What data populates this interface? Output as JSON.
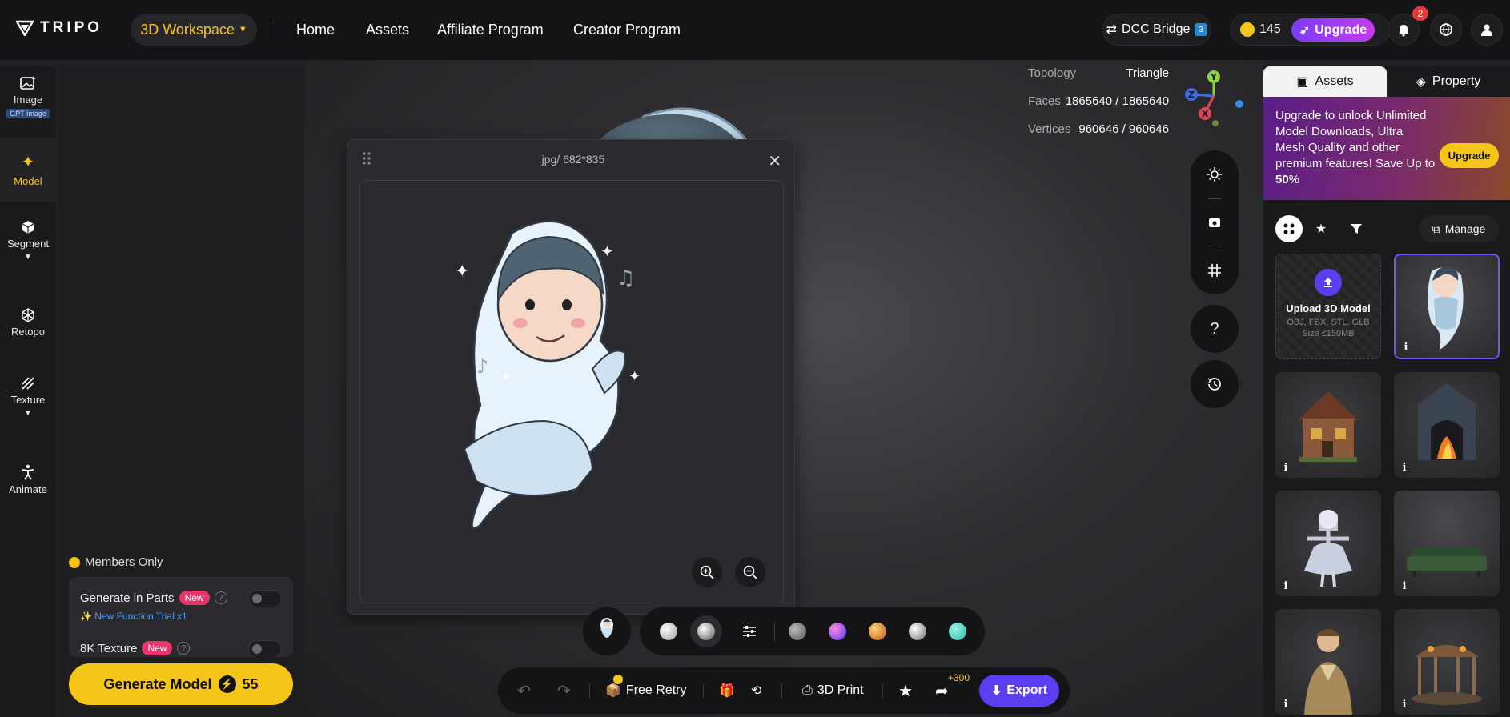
{
  "header": {
    "logo": "TRIPO",
    "workspace": "3D Workspace",
    "nav": [
      "Home",
      "Assets",
      "Affiliate Program",
      "Creator Program"
    ],
    "dcc_bridge": "DCC Bridge",
    "credits": "145",
    "upgrade": "Upgrade",
    "notifications": "2"
  },
  "leftnav": {
    "items": [
      {
        "label": "Image",
        "badge": "GPT Image"
      },
      {
        "label": "Model"
      },
      {
        "label": "Segment"
      },
      {
        "label": "Retopo"
      },
      {
        "label": "Texture"
      },
      {
        "label": "Animate"
      }
    ]
  },
  "panel": {
    "members_only": "Members Only",
    "generate_parts": "Generate in Parts",
    "new_badge": "New",
    "trial": "New Function Trial x1",
    "texture_8k": "8K Texture",
    "generate_label": "Generate Model",
    "generate_cost": "55"
  },
  "preview": {
    "title": ".jpg/ 682*835"
  },
  "stats": {
    "topology_label": "Topology",
    "topology_value": "Triangle",
    "faces_label": "Faces",
    "faces_value": "1865640 / 1865640",
    "vertices_label": "Vertices",
    "vertices_value": "960646 / 960646"
  },
  "axes": {
    "x": "X",
    "y": "Y",
    "z": "Z"
  },
  "materials": {
    "colors": [
      "#d6d6d6",
      "#8a8a8e",
      "#4e6cf0",
      "#e08a2a",
      "#a8a8ac",
      "#3fd6c0"
    ]
  },
  "bottombar": {
    "free_retry": "Free Retry",
    "print": "3D Print",
    "bonus": "+300",
    "export": "Export"
  },
  "rightpanel": {
    "tab_assets": "Assets",
    "tab_property": "Property",
    "promo_line1": "Upgrade to unlock Unlimited Model Downloads, Ultra Mesh Quality and other premium features!  Save Up to ",
    "promo_percent": "50",
    "promo_pct_sign": "%",
    "promo_button": "Upgrade",
    "manage": "Manage",
    "upload_title": "Upload 3D Model",
    "upload_formats": "OBJ, FBX, STL, GLB",
    "upload_size": "Size ≤150MB"
  }
}
